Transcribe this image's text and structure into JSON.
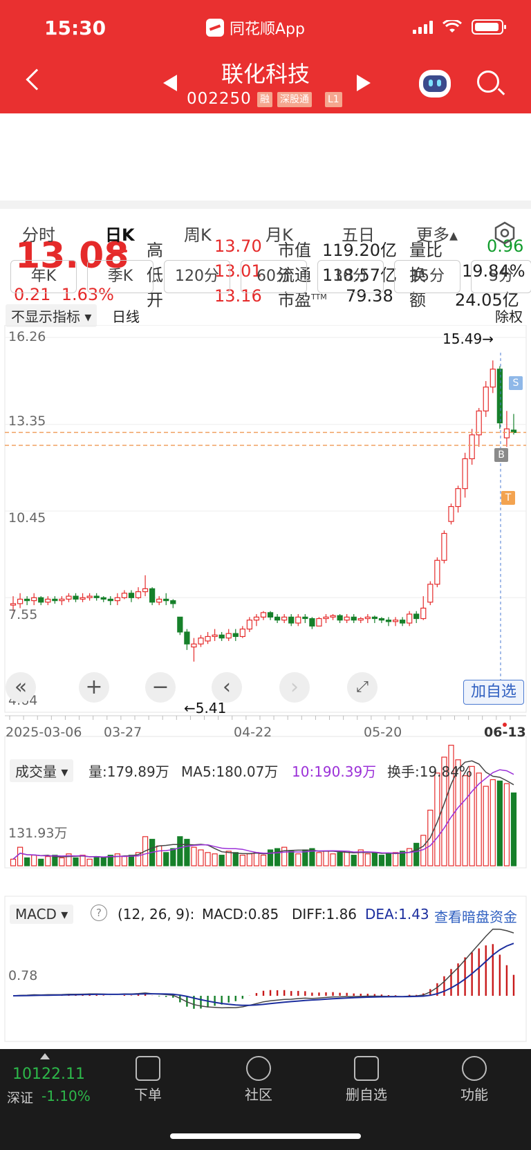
{
  "status_bar": {
    "time": "15:30",
    "app": "同花顺App"
  },
  "header": {
    "stock_name": "联化科技",
    "code": "002250",
    "tags": [
      "融",
      "深股通",
      "L1"
    ]
  },
  "quote": {
    "price": "13.08",
    "change": "0.21",
    "change_pct": "1.63%",
    "high_label": "高",
    "high": "13.70",
    "low_label": "低",
    "low": "13.01",
    "open_label": "开",
    "open": "13.16",
    "mcap_label": "市值",
    "mcap": "119.20亿",
    "float_label": "流通",
    "float": "118.57亿",
    "pe_label": "市盈",
    "pe_sup": "TTM",
    "pe": "79.38",
    "vr_label": "量比",
    "vr": "0.96",
    "turn_label": "换",
    "turn": "19.84%",
    "amt_label": "额",
    "amt": "24.05亿"
  },
  "tabs": [
    "分时",
    "日K",
    "周K",
    "月K",
    "五日",
    "更多▴"
  ],
  "periods": [
    "年K",
    "季K",
    "120分",
    "60分",
    "30分",
    "15分",
    "5分"
  ],
  "kline": {
    "indicator_btn": "不显示指标 ▾",
    "line_type": "日线",
    "adjust": "除权",
    "y_labels": [
      "16.26",
      "13.35",
      "10.45",
      "7.55",
      "4.64"
    ],
    "max_label": "15.49→",
    "min_label": "←5.41",
    "dates": [
      "2025-03-06",
      "03-27",
      "04-22",
      "05-20",
      "06-13"
    ],
    "add_watch": "加自选",
    "markers": {
      "s": "S",
      "b": "B",
      "t": "T"
    }
  },
  "volume": {
    "btn": "成交量 ▾",
    "vol": "量:179.89万",
    "ma5": "MA5:180.07万",
    "ma10": "10:190.39万",
    "turnover": "换手:19.84%",
    "y_label": "131.93万"
  },
  "macd": {
    "btn": "MACD ▾",
    "help": "?",
    "params": "(12, 26, 9):",
    "macd": "MACD:0.85",
    "diff": "DIFF:1.86",
    "dea": "DEA:1.43",
    "link": "查看暗盘资金",
    "y_label": "0.78"
  },
  "bottom_nav": {
    "index_value": "10122.11",
    "index_name": "深证",
    "index_change": "-1.10%",
    "items": [
      "下单",
      "社区",
      "删自选",
      "功能"
    ]
  },
  "chart_data": {
    "type": "candlestick",
    "series": [
      {
        "name": "daily",
        "values": [
          [
            7.3,
            7.35,
            7.1,
            7.6
          ],
          [
            7.35,
            7.5,
            7.2,
            7.7
          ],
          [
            7.5,
            7.45,
            7.3,
            7.6
          ],
          [
            7.45,
            7.55,
            7.3,
            7.7
          ],
          [
            7.55,
            7.4,
            7.3,
            7.6
          ],
          [
            7.4,
            7.5,
            7.3,
            7.6
          ],
          [
            7.5,
            7.45,
            7.35,
            7.6
          ],
          [
            7.45,
            7.5,
            7.3,
            7.6
          ],
          [
            7.5,
            7.6,
            7.4,
            7.7
          ],
          [
            7.6,
            7.5,
            7.4,
            7.7
          ],
          [
            7.5,
            7.55,
            7.4,
            7.7
          ],
          [
            7.55,
            7.6,
            7.45,
            7.7
          ],
          [
            7.6,
            7.55,
            7.45,
            7.7
          ],
          [
            7.55,
            7.5,
            7.4,
            7.6
          ],
          [
            7.5,
            7.45,
            7.3,
            7.6
          ],
          [
            7.45,
            7.55,
            7.3,
            7.7
          ],
          [
            7.55,
            7.7,
            7.5,
            7.8
          ],
          [
            7.7,
            7.55,
            7.4,
            7.8
          ],
          [
            7.55,
            7.75,
            7.5,
            7.9
          ],
          [
            7.75,
            7.85,
            7.6,
            8.3
          ],
          [
            7.85,
            7.4,
            7.3,
            7.9
          ],
          [
            7.4,
            7.5,
            7.3,
            7.6
          ],
          [
            7.5,
            7.45,
            7.3,
            7.7
          ],
          [
            7.45,
            7.35,
            7.2,
            7.5
          ],
          [
            6.9,
            6.4,
            6.3,
            6.9
          ],
          [
            6.4,
            6.0,
            5.8,
            6.5
          ],
          [
            5.9,
            6.0,
            5.41,
            6.2
          ],
          [
            6.0,
            6.2,
            5.9,
            6.3
          ],
          [
            6.1,
            6.25,
            6.0,
            6.4
          ],
          [
            6.25,
            6.3,
            6.1,
            6.5
          ],
          [
            6.3,
            6.2,
            6.1,
            6.4
          ],
          [
            6.2,
            6.35,
            6.1,
            6.5
          ],
          [
            6.35,
            6.25,
            6.1,
            6.5
          ],
          [
            6.25,
            6.5,
            6.2,
            6.6
          ],
          [
            6.5,
            6.8,
            6.4,
            6.9
          ],
          [
            6.8,
            6.9,
            6.6,
            7.0
          ],
          [
            6.9,
            7.05,
            6.8,
            7.1
          ],
          [
            7.05,
            6.9,
            6.8,
            7.1
          ],
          [
            6.9,
            6.8,
            6.7,
            7.0
          ],
          [
            6.8,
            6.9,
            6.7,
            7.0
          ],
          [
            6.9,
            6.7,
            6.6,
            7.0
          ],
          [
            6.7,
            6.9,
            6.6,
            7.0
          ],
          [
            6.9,
            6.85,
            6.7,
            7.0
          ],
          [
            6.85,
            6.6,
            6.5,
            6.9
          ],
          [
            6.6,
            6.85,
            6.6,
            6.9
          ],
          [
            6.85,
            6.9,
            6.7,
            7.0
          ],
          [
            6.9,
            6.95,
            6.8,
            7.0
          ],
          [
            6.95,
            6.8,
            6.7,
            7.0
          ],
          [
            6.8,
            6.9,
            6.7,
            7.0
          ],
          [
            6.9,
            6.8,
            6.7,
            7.0
          ],
          [
            6.8,
            6.85,
            6.7,
            6.9
          ],
          [
            6.85,
            6.9,
            6.7,
            7.0
          ],
          [
            6.9,
            6.85,
            6.7,
            6.95
          ],
          [
            6.85,
            6.8,
            6.7,
            6.9
          ],
          [
            6.8,
            6.75,
            6.6,
            6.9
          ],
          [
            6.75,
            6.8,
            6.6,
            6.9
          ],
          [
            6.8,
            6.7,
            6.6,
            6.9
          ],
          [
            6.7,
            7.0,
            6.6,
            7.1
          ],
          [
            7.0,
            6.85,
            6.7,
            7.1
          ],
          [
            6.85,
            7.2,
            6.8,
            7.6
          ],
          [
            7.4,
            8.0,
            7.3,
            8.1
          ],
          [
            8.0,
            8.8,
            7.9,
            8.9
          ],
          [
            8.8,
            9.7,
            8.7,
            9.8
          ],
          [
            10.1,
            10.6,
            10.0,
            10.7
          ],
          [
            10.6,
            11.2,
            10.4,
            11.3
          ],
          [
            11.2,
            12.2,
            10.9,
            12.4
          ],
          [
            12.2,
            13.0,
            12.0,
            13.2
          ],
          [
            13.0,
            13.8,
            12.6,
            13.9
          ],
          [
            13.8,
            14.6,
            13.6,
            14.8
          ],
          [
            14.6,
            15.2,
            14.4,
            15.49
          ],
          [
            15.2,
            13.4,
            13.2,
            15.3
          ],
          [
            12.9,
            13.2,
            12.6,
            13.8
          ],
          [
            13.16,
            13.08,
            13.01,
            13.7
          ]
        ]
      }
    ],
    "volume_series": [
      5,
      14,
      6,
      8,
      5,
      7,
      8,
      6,
      9,
      6,
      8,
      5,
      7,
      6,
      8,
      9,
      7,
      8,
      10,
      22,
      20,
      15,
      10,
      13,
      22,
      20,
      14,
      12,
      10,
      9,
      8,
      11,
      10,
      8,
      9,
      10,
      8,
      12,
      13,
      14,
      11,
      9,
      12,
      13,
      10,
      11,
      9,
      10,
      11,
      8,
      12,
      9,
      10,
      8,
      9,
      10,
      11,
      13,
      17,
      23,
      42,
      70,
      82,
      91,
      80,
      68,
      75,
      70,
      60,
      65,
      64,
      62,
      55
    ],
    "y_range": [
      4.64,
      16.26
    ]
  }
}
